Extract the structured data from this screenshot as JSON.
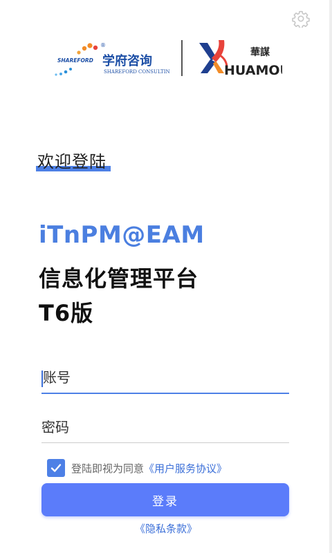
{
  "header": {
    "settings_icon": "gear-icon"
  },
  "logos": {
    "shareford_cn": "学府咨询",
    "shareford_en": "SHAREFORD CONSULTING",
    "shareford_mark": "SHAREFORD",
    "registered": "®",
    "huamou_cn": "華謀",
    "huamou_en": "HUAMOU"
  },
  "welcome": "欢迎登陆",
  "title": {
    "english": "iTnPM@EAM",
    "chinese": "信息化管理平台",
    "version": "T6版"
  },
  "form": {
    "account_placeholder": "账号",
    "password_placeholder": "密码",
    "agreement_checked": true,
    "agreement_prefix": "登陆即视为同意",
    "agreement_link": "《用户服务协议》",
    "login_label": "登录",
    "privacy_link": "《隐私条款》"
  },
  "colors": {
    "accent": "#4d80e6",
    "button": "#5b7cfa",
    "link": "#3b6fd8"
  }
}
